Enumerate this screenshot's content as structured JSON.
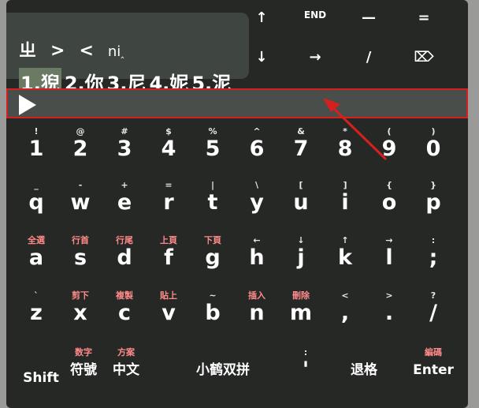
{
  "composition": {
    "text": "ㄓ",
    "gt": ">",
    "lt": "<",
    "pinyin": "ni",
    "cursor": "‸"
  },
  "candidates": [
    "1.猊",
    "2.你",
    "3.尼",
    "4.妮",
    "5.泥"
  ],
  "top_fn": [
    {
      "name": "up-arrow-key",
      "label": "↑"
    },
    {
      "name": "end-key",
      "label": "END"
    },
    {
      "name": "minus-key",
      "label": "—"
    },
    {
      "name": "equals-key",
      "label": "="
    },
    {
      "name": "down-arrow-key",
      "label": "↓"
    },
    {
      "name": "right-arrow-key",
      "label": "→"
    },
    {
      "name": "slash-key",
      "label": "/"
    },
    {
      "name": "delete-icon",
      "label": "⌦"
    }
  ],
  "rows": [
    [
      {
        "sub": "!",
        "main": "1"
      },
      {
        "sub": "@",
        "main": "2"
      },
      {
        "sub": "#",
        "main": "3"
      },
      {
        "sub": "$",
        "main": "4"
      },
      {
        "sub": "%",
        "main": "5"
      },
      {
        "sub": "^",
        "main": "6"
      },
      {
        "sub": "&",
        "main": "7"
      },
      {
        "sub": "*",
        "main": "8"
      },
      {
        "sub": "(",
        "main": "9"
      },
      {
        "sub": ")",
        "main": "0"
      }
    ],
    [
      {
        "sub": "_",
        "main": "q"
      },
      {
        "sub": "-",
        "main": "w"
      },
      {
        "sub": "+",
        "main": "e"
      },
      {
        "sub": "=",
        "main": "r"
      },
      {
        "sub": "|",
        "main": "t"
      },
      {
        "sub": "\\",
        "main": "y"
      },
      {
        "sub": "[",
        "main": "u"
      },
      {
        "sub": "]",
        "main": "i"
      },
      {
        "sub": "{",
        "main": "o"
      },
      {
        "sub": "}",
        "main": "p"
      }
    ],
    [
      {
        "sub": "全選",
        "main": "a"
      },
      {
        "sub": "行首",
        "main": "s"
      },
      {
        "sub": "行尾",
        "main": "d"
      },
      {
        "sub": "上頁",
        "main": "f"
      },
      {
        "sub": "下頁",
        "main": "g"
      },
      {
        "sub": "←",
        "main": "h"
      },
      {
        "sub": "↓",
        "main": "j"
      },
      {
        "sub": "↑",
        "main": "k"
      },
      {
        "sub": "→",
        "main": "l"
      },
      {
        "sub": ":",
        "main": ";"
      }
    ],
    [
      {
        "sub": "`",
        "main": "z"
      },
      {
        "sub": "剪下",
        "main": "x"
      },
      {
        "sub": "複製",
        "main": "c"
      },
      {
        "sub": "貼上",
        "main": "v"
      },
      {
        "sub": "~",
        "main": "b"
      },
      {
        "sub": "插入",
        "main": "n"
      },
      {
        "sub": "刪除",
        "main": "m"
      },
      {
        "sub": "<",
        "main": ","
      },
      {
        "sub": ">",
        "main": "."
      },
      {
        "sub": "?",
        "main": "/"
      }
    ]
  ],
  "bottom": {
    "shift": "Shift",
    "symbols_sub": "数字",
    "symbols": "符號",
    "chinese_sub": "方案",
    "chinese": "中文",
    "space": "小鹤双拼",
    "quote_sub": ":",
    "quote": "'",
    "backspace": "退格",
    "enter_sub": "編碼",
    "enter": "Enter"
  }
}
